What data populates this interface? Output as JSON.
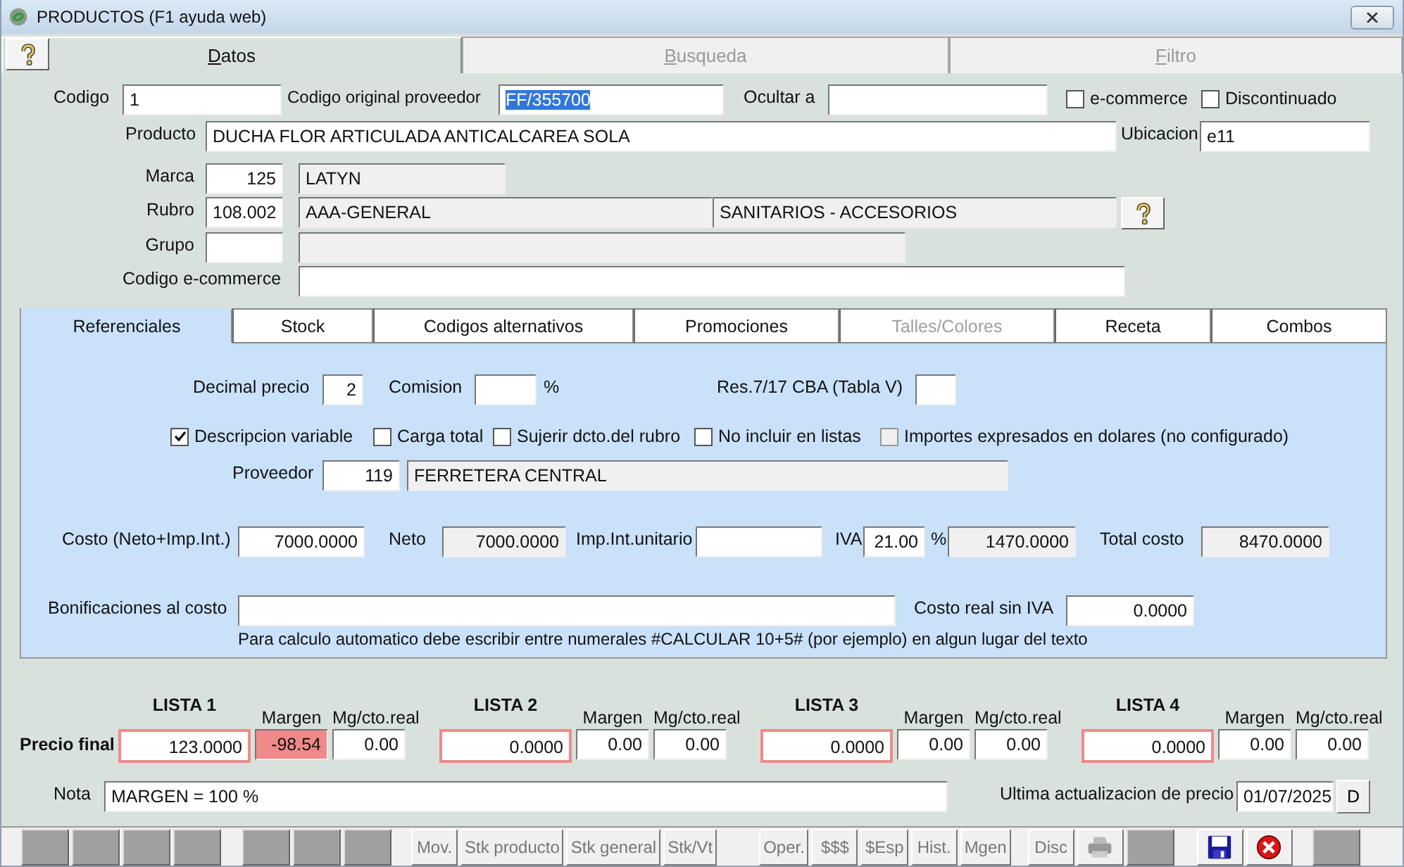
{
  "window": {
    "title": "PRODUCTOS (F1 ayuda web)"
  },
  "main_tabs": [
    {
      "label": "Datos",
      "selected": true,
      "disabled": false
    },
    {
      "label": "Busqueda",
      "selected": false,
      "disabled": true
    },
    {
      "label": "Filtro",
      "selected": false,
      "disabled": true
    }
  ],
  "codigo": {
    "label": "Codigo",
    "value": "1"
  },
  "codigo_original": {
    "label": "Codigo original proveedor",
    "value": "FF/355700",
    "text_selected": true
  },
  "ocultar": {
    "label": "Ocultar a"
  },
  "flags": [
    {
      "label": "e-commerce",
      "checked": false
    },
    {
      "label": "Discontinuado",
      "checked": false
    }
  ],
  "producto": {
    "label": "Producto",
    "value": "DUCHA FLOR ARTICULADA ANTICALCAREA SOLA"
  },
  "ubicacion": {
    "label": "Ubicacion",
    "value": "e11"
  },
  "marca": {
    "label": "Marca",
    "code": "125",
    "name": "LATYN"
  },
  "rubro": {
    "label": "Rubro",
    "code": "108.002",
    "name": "AAA-GENERAL",
    "subname": "SANITARIOS - ACCESORIOS"
  },
  "grupo": {
    "label": "Grupo"
  },
  "codigo_ecommerce": {
    "label": "Codigo e-commerce"
  },
  "sub_tabs": [
    {
      "label": "Referenciales",
      "selected": true,
      "disabled": false
    },
    {
      "label": "Stock",
      "selected": false,
      "disabled": false
    },
    {
      "label": "Codigos alternativos",
      "selected": false,
      "disabled": false
    },
    {
      "label": "Promociones",
      "selected": false,
      "disabled": false
    },
    {
      "label": "Talles/Colores",
      "selected": false,
      "disabled": true
    },
    {
      "label": "Receta",
      "selected": false,
      "disabled": false
    },
    {
      "label": "Combos",
      "selected": false,
      "disabled": false
    }
  ],
  "decimal_precio": {
    "label": "Decimal precio",
    "value": "2"
  },
  "comision": {
    "label": "Comision",
    "unit": "%"
  },
  "res": {
    "label": "Res.7/17 CBA (Tabla V)"
  },
  "options": [
    {
      "label": "Descripcion variable",
      "checked": true,
      "disabled": false
    },
    {
      "label": "Carga total",
      "checked": false,
      "disabled": false
    },
    {
      "label": "Sujerir dcto.del rubro",
      "checked": false,
      "disabled": false
    },
    {
      "label": "No incluir en listas",
      "checked": false,
      "disabled": false
    },
    {
      "label": "Importes expresados en dolares (no configurado)",
      "checked": false,
      "disabled": true
    }
  ],
  "proveedor": {
    "label": "Proveedor",
    "code": "119",
    "name": "FERRETERA CENTRAL"
  },
  "costo": {
    "label": "Costo (Neto+Imp.Int.)",
    "value": "7000.0000"
  },
  "neto": {
    "label": "Neto",
    "value": "7000.0000"
  },
  "imp_int": {
    "label": "Imp.Int.unitario"
  },
  "iva": {
    "label": "IVA",
    "rate": "21.00",
    "unit": "%",
    "amount": "1470.0000"
  },
  "total_costo": {
    "label": "Total costo",
    "value": "8470.0000"
  },
  "bonificaciones": {
    "label": "Bonificaciones al costo"
  },
  "costo_real": {
    "label": "Costo real sin IVA",
    "value": "0.0000"
  },
  "hint": "Para calculo automatico debe escribir entre numerales #CALCULAR 10+5# (por ejemplo) en algun lugar del texto",
  "precio_final_label": "Precio final",
  "listas": [
    {
      "title": "LISTA 1",
      "margen_label": "Margen",
      "mg_label": "Mg/cto.real",
      "precio": "123.0000",
      "margen": "-98.54",
      "margen_alert": true,
      "mg_cto_real": "0.00"
    },
    {
      "title": "LISTA 2",
      "margen_label": "Margen",
      "mg_label": "Mg/cto.real",
      "precio": "0.0000",
      "margen": "0.00",
      "margen_alert": false,
      "mg_cto_real": "0.00"
    },
    {
      "title": "LISTA 3",
      "margen_label": "Margen",
      "mg_label": "Mg/cto.real",
      "precio": "0.0000",
      "margen": "0.00",
      "margen_alert": false,
      "mg_cto_real": "0.00"
    },
    {
      "title": "LISTA 4",
      "margen_label": "Margen",
      "mg_label": "Mg/cto.real",
      "precio": "0.0000",
      "margen": "0.00",
      "margen_alert": false,
      "mg_cto_real": "0.00"
    }
  ],
  "nota": {
    "label": "Nota",
    "value": "MARGEN = 100 %"
  },
  "ultima_actualizacion": {
    "label": "Ultima actualizacion de precio",
    "value": "01/07/2025",
    "button": "D"
  },
  "toolbar": [
    {
      "items": [
        {
          "kind": "blank"
        },
        {
          "kind": "blank"
        },
        {
          "kind": "blank"
        },
        {
          "kind": "blank"
        }
      ]
    },
    {
      "items": [
        {
          "kind": "blank"
        },
        {
          "kind": "blank"
        },
        {
          "kind": "blank"
        }
      ]
    },
    {
      "items": [
        {
          "kind": "text",
          "label": "Mov."
        },
        {
          "kind": "text",
          "label": "Stk producto"
        },
        {
          "kind": "text",
          "label": "Stk general"
        },
        {
          "kind": "text",
          "label": "Stk/Vt"
        }
      ]
    },
    {
      "items": [
        {
          "kind": "text",
          "label": "Oper."
        },
        {
          "kind": "text",
          "label": "$$$"
        },
        {
          "kind": "text",
          "label": "$Esp"
        },
        {
          "kind": "text",
          "label": "Hist."
        },
        {
          "kind": "text",
          "label": "Mgen"
        }
      ]
    },
    {
      "items": [
        {
          "kind": "text",
          "label": "Disc"
        },
        {
          "kind": "printer"
        },
        {
          "kind": "blank"
        }
      ]
    },
    {
      "items": [
        {
          "kind": "save"
        },
        {
          "kind": "cancel"
        }
      ]
    },
    {
      "items": [
        {
          "kind": "blank"
        }
      ]
    }
  ]
}
